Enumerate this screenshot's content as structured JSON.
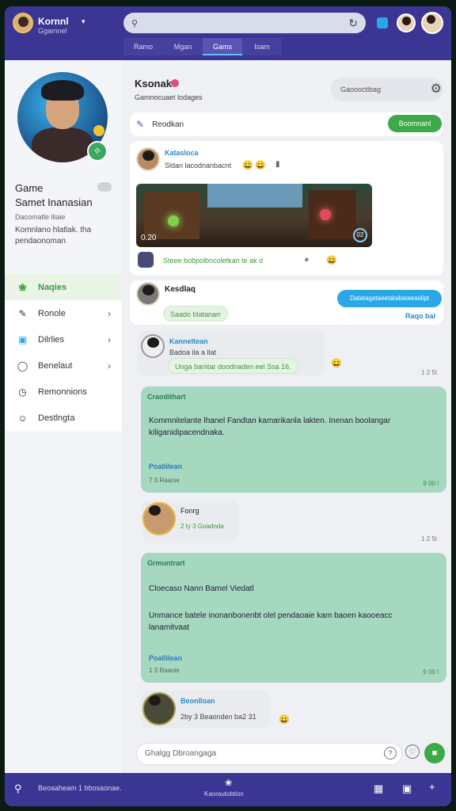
{
  "topbar": {
    "user_name": "Kornnl",
    "user_sub": "Ggamnel",
    "search_placeholder": "",
    "search_value": "",
    "tabs": [
      "Ramo",
      "Mgan",
      "Gams",
      "Isam"
    ],
    "active_tab": 2,
    "accent": "#3b3593"
  },
  "sidebar": {
    "title_line1": "Game",
    "title_line2": "Samet Inanasian",
    "small": "Dacomatle lliaie",
    "desc": "Komnlano hlatlak. tha pendaonoman",
    "nav": [
      {
        "label": "Naqies",
        "icon": "leaf-icon",
        "active": true,
        "chevron": false
      },
      {
        "label": "Ronole",
        "icon": "pen-icon",
        "active": false,
        "chevron": true
      },
      {
        "label": "Dilrlies",
        "icon": "library-icon",
        "active": false,
        "chevron": true
      },
      {
        "label": "Benelaut",
        "icon": "chat-icon",
        "active": false,
        "chevron": true
      },
      {
        "label": "Remonnions",
        "icon": "clock-icon",
        "active": false,
        "chevron": false
      },
      {
        "label": "Destlngta",
        "icon": "smile-icon",
        "active": false,
        "chevron": false
      }
    ]
  },
  "header": {
    "name": "Ksonak",
    "sub": "Gamnocuaet lodages",
    "pill": "Gaoooctibag"
  },
  "compose": {
    "placeholder": "Reodkan",
    "send": "Boomnanl"
  },
  "post1": {
    "name": "Katasloca",
    "text": "Sldan lacodnanbacnt",
    "video_time": "0.20",
    "video_ctrl": "02",
    "footer": "Steee bobpolbncoletkan te ak d"
  },
  "post2": {
    "name": "Kesdlaq",
    "tag": "Saado blatanarr",
    "bubble": "Datatagataeetatabataeaslipt",
    "reply": "Raqo bal"
  },
  "post3": {
    "name": "Kanneltean",
    "sub": "Badoa ila a llat",
    "body": "Unga banitar doodnaden eel Ssa 16.",
    "time": "1 2 5t"
  },
  "mint1": {
    "title": "Craodithart",
    "body": "Kommnitelante lhanel Fandtan kamarikanla lakten. Inenan boolangar kiliganidipacendnaka.",
    "footer": "Poaliilean",
    "sub": "7 3 Raanie",
    "right": "9 00 l"
  },
  "post4": {
    "name": "Fonrg",
    "sub": "2 ty 3 Goadnda",
    "time": "1 2 5t"
  },
  "mint2": {
    "title": "Grmuntrart",
    "body1": "Cloecaso Nann Bamel Viedatl",
    "body2": "Unmance batele inonanbonenbt olel pendaoaie kam baoen kaooeacc lanamitvaat",
    "footer": "Poaliilean",
    "sub": "1 3 Raanie",
    "right": "9 00 l"
  },
  "post5": {
    "name": "Beonlloan",
    "sub": "2by 3 Beaonden ba2 31"
  },
  "composer": {
    "placeholder": "Ghalgg Dbroangaga"
  },
  "bottombar": {
    "text": "Beoaaheam 1 bbosaonae.",
    "center": "Kaorautobtion"
  }
}
